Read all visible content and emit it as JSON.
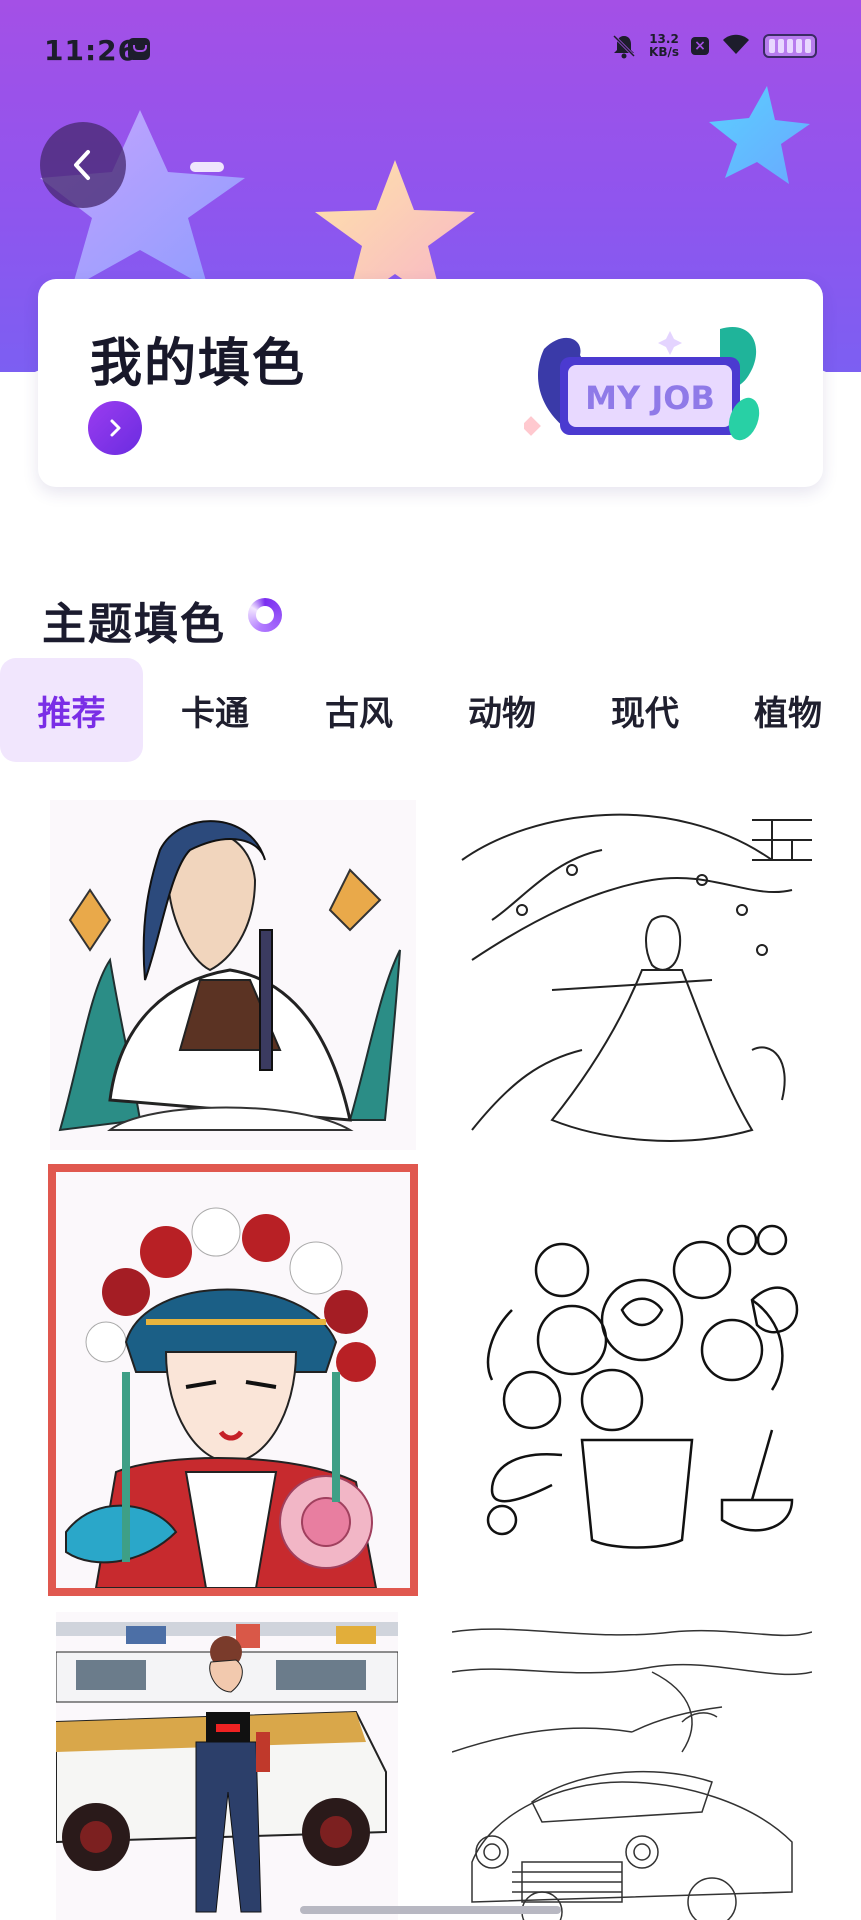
{
  "status_bar": {
    "time": "11:26",
    "net_speed_value": "13.2",
    "net_speed_unit": "KB/s"
  },
  "header": {
    "back_icon": "chevron-left-icon"
  },
  "my_card": {
    "title": "我的填色",
    "badge_text": "MY JOB",
    "arrow_icon": "chevron-right-icon"
  },
  "section": {
    "title": "主题填色"
  },
  "tabs": [
    {
      "label": "推荐",
      "active": true
    },
    {
      "label": "卡通",
      "active": false
    },
    {
      "label": "古风",
      "active": false
    },
    {
      "label": "动物",
      "active": false
    },
    {
      "label": "现代",
      "active": false
    },
    {
      "label": "植物",
      "active": false
    }
  ],
  "colors": {
    "accent": "#7a2ee6",
    "header_gradient_top": "#a450e6",
    "highlight_border": "#e0584f",
    "tab_active_bg": "#f1e6fd"
  },
  "gallery": [
    {
      "subject": "ancient-warrior-colored"
    },
    {
      "subject": "flute-player-lineart"
    },
    {
      "subject": "opera-lady-colored"
    },
    {
      "subject": "rose-bouquet-lineart"
    },
    {
      "subject": "street-girl-colored"
    },
    {
      "subject": "vintage-car-lineart"
    }
  ]
}
